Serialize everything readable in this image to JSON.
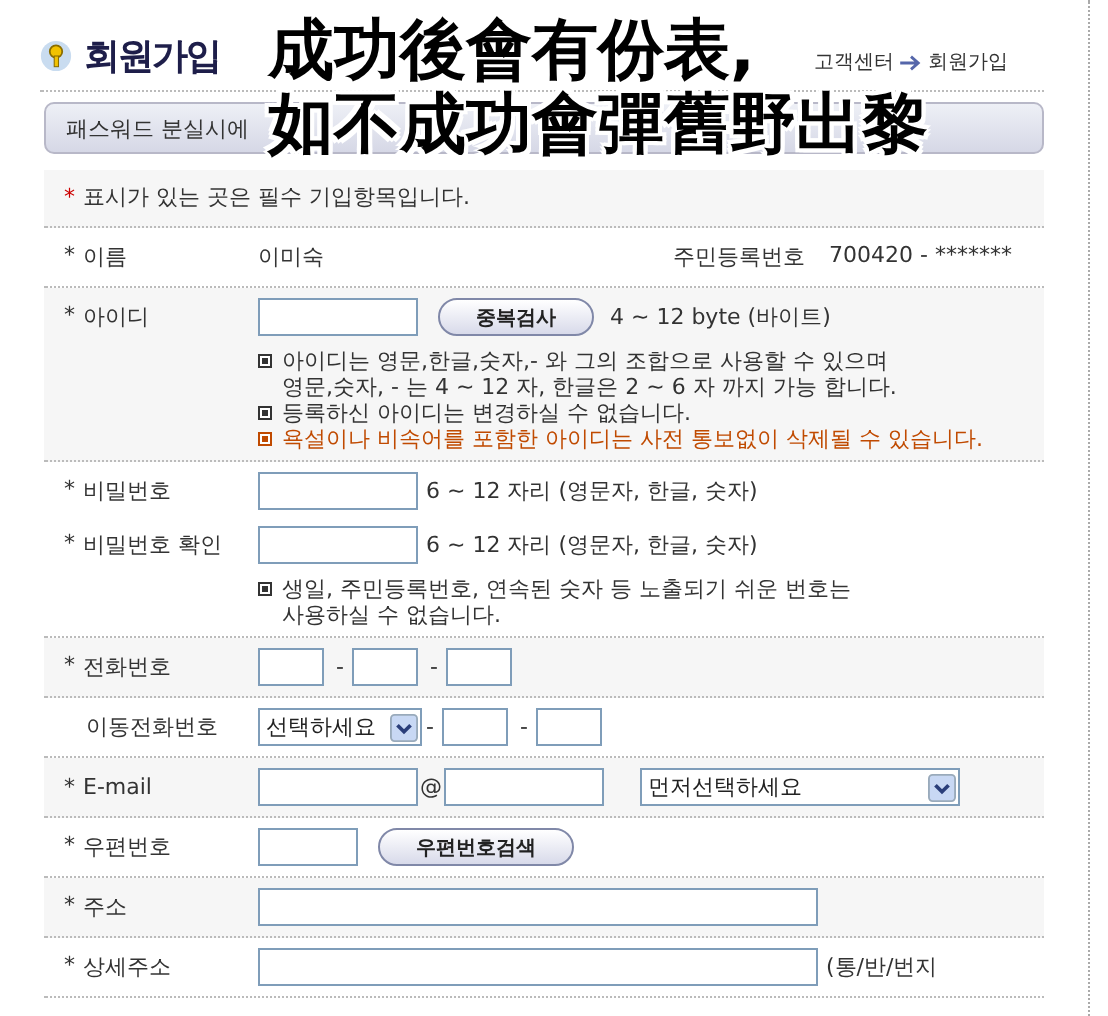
{
  "header": {
    "title": "회원가입",
    "breadcrumb": [
      "고객센터",
      "회원가입"
    ],
    "notice_bar": "패스워드 분실시에"
  },
  "caption": [
    "成功後會有份表,",
    "如不成功會彈舊野出黎"
  ],
  "required_note": {
    "mark": "*",
    "text": "표시가 있는 곳은 필수 기입항목입니다."
  },
  "sections": [
    {
      "rows": [
        {
          "mark": "*",
          "label": "이름",
          "controls": [
            {
              "kind": "text",
              "text": "이미숙"
            },
            {
              "kind": "aside",
              "label": "주민등록번호",
              "value": "700420 - *******"
            }
          ]
        }
      ]
    },
    {
      "rows": [
        {
          "mark": "*",
          "label": "아이디",
          "controls": [
            {
              "kind": "input"
            },
            {
              "kind": "button",
              "text": "중복검사"
            },
            {
              "kind": "text",
              "text": "4 ~ 12 byte (바이트)"
            }
          ]
        }
      ],
      "notes": [
        {
          "lines": [
            "아이디는 영문,한글,숫자,- 와 그의 조합으로 사용할 수 있으며",
            "영문,숫자, - 는 4 ~ 12 자, 한글은 2 ~ 6 자 까지 가능 합니다."
          ],
          "warning": false
        },
        {
          "lines": [
            "등록하신 아이디는 변경하실 수 없습니다."
          ],
          "warning": false
        },
        {
          "lines": [
            "욕설이나 비속어를 포함한 아이디는 사전 통보없이 삭제될 수 있습니다."
          ],
          "warning": true
        }
      ]
    },
    {
      "rows": [
        {
          "mark": "*",
          "label": "비밀번호",
          "controls": [
            {
              "kind": "input"
            },
            {
              "kind": "text",
              "text": "6 ~ 12 자리 (영문자, 한글, 숫자)"
            }
          ]
        },
        {
          "mark": "*",
          "label": "비밀번호 확인",
          "controls": [
            {
              "kind": "input"
            },
            {
              "kind": "text",
              "text": "6 ~ 12 자리 (영문자, 한글, 숫자)"
            }
          ]
        }
      ],
      "notes": [
        {
          "lines": [
            "생일, 주민등록번호, 연속된 숫자 등 노출되기 쉬운 번호는",
            "사용하실 수 없습니다."
          ],
          "warning": false
        }
      ]
    },
    {
      "rows": [
        {
          "mark": "*",
          "label": "전화번호",
          "controls": [
            {
              "kind": "short_input"
            },
            {
              "kind": "sep",
              "text": "-"
            },
            {
              "kind": "short_input"
            },
            {
              "kind": "sep",
              "text": "-"
            },
            {
              "kind": "short_input"
            }
          ]
        }
      ]
    },
    {
      "rows": [
        {
          "label": "이동전화번호",
          "controls": [
            {
              "kind": "select",
              "text": "선택하세요"
            },
            {
              "kind": "sep",
              "text": "-"
            },
            {
              "kind": "short_input"
            },
            {
              "kind": "sep",
              "text": "-"
            },
            {
              "kind": "short_input"
            }
          ]
        }
      ]
    },
    {
      "rows": [
        {
          "mark": "*",
          "label": "E-mail",
          "controls": [
            {
              "kind": "input"
            },
            {
              "kind": "at",
              "text": "@"
            },
            {
              "kind": "input"
            },
            {
              "kind": "wide_select",
              "text": "먼저선택하세요"
            }
          ]
        }
      ]
    },
    {
      "rows": [
        {
          "mark": "*",
          "label": "우편번호",
          "controls": [
            {
              "kind": "zip_input"
            },
            {
              "kind": "button",
              "text": "우편번호검색"
            }
          ]
        }
      ]
    },
    {
      "rows": [
        {
          "mark": "*",
          "label": "주소",
          "controls": [
            {
              "kind": "wide_input"
            }
          ]
        }
      ]
    },
    {
      "rows": [
        {
          "mark": "*",
          "label": "상세주소",
          "controls": [
            {
              "kind": "wide_input"
            },
            {
              "kind": "text",
              "text": "(통/반/번지"
            }
          ]
        }
      ]
    }
  ]
}
